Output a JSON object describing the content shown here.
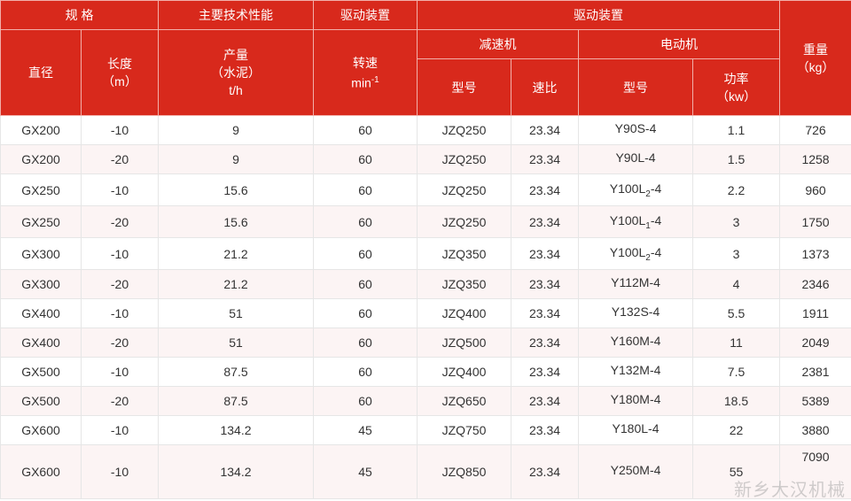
{
  "header": {
    "spec": "规 格",
    "main_tech": "主要技术性能",
    "drive1": "驱动装置",
    "drive2": "驱动装置",
    "weight_label": "重量",
    "weight_unit": "（kg）",
    "diameter": "直径",
    "length_label": "长度",
    "length_unit": "（m）",
    "output_label": "产量",
    "output_sub": "（水泥）",
    "output_unit": "t/h",
    "speed_label": "转速",
    "speed_unit_base": "min",
    "speed_unit_exp": "-1",
    "reducer": "减速机",
    "motor": "电动机",
    "reducer_model": "型号",
    "ratio": "速比",
    "motor_model": "型号",
    "power_label": "功率",
    "power_unit": "（kw）"
  },
  "rows": [
    {
      "diameter": "GX200",
      "length": "-10",
      "output": "9",
      "speed": "60",
      "reducer": "JZQ250",
      "ratio": "23.34",
      "motor_pre": "Y90S-4",
      "motor_sub": "",
      "motor_post": "",
      "power": "1.1",
      "weight": "726"
    },
    {
      "diameter": "GX200",
      "length": "-20",
      "output": "9",
      "speed": "60",
      "reducer": "JZQ250",
      "ratio": "23.34",
      "motor_pre": "Y90L-4",
      "motor_sub": "",
      "motor_post": "",
      "power": "1.5",
      "weight": "1258"
    },
    {
      "diameter": "GX250",
      "length": "-10",
      "output": "15.6",
      "speed": "60",
      "reducer": "JZQ250",
      "ratio": "23.34",
      "motor_pre": "Y100L",
      "motor_sub": "2",
      "motor_post": "-4",
      "power": "2.2",
      "weight": "960"
    },
    {
      "diameter": "GX250",
      "length": "-20",
      "output": "15.6",
      "speed": "60",
      "reducer": "JZQ250",
      "ratio": "23.34",
      "motor_pre": "Y100L",
      "motor_sub": "1",
      "motor_post": "-4",
      "power": "3",
      "weight": "1750"
    },
    {
      "diameter": "GX300",
      "length": "-10",
      "output": "21.2",
      "speed": "60",
      "reducer": "JZQ350",
      "ratio": "23.34",
      "motor_pre": "Y100L",
      "motor_sub": "2",
      "motor_post": "-4",
      "power": "3",
      "weight": "1373"
    },
    {
      "diameter": "GX300",
      "length": "-20",
      "output": "21.2",
      "speed": "60",
      "reducer": "JZQ350",
      "ratio": "23.34",
      "motor_pre": "Y112M-4",
      "motor_sub": "",
      "motor_post": "",
      "power": "4",
      "weight": "2346"
    },
    {
      "diameter": "GX400",
      "length": "-10",
      "output": "51",
      "speed": "60",
      "reducer": "JZQ400",
      "ratio": "23.34",
      "motor_pre": "Y132S-4",
      "motor_sub": "",
      "motor_post": "",
      "power": "5.5",
      "weight": "1911"
    },
    {
      "diameter": "GX400",
      "length": "-20",
      "output": "51",
      "speed": "60",
      "reducer": "JZQ500",
      "ratio": "23.34",
      "motor_pre": "Y160M-4",
      "motor_sub": "",
      "motor_post": "",
      "power": "11",
      "weight": "2049"
    },
    {
      "diameter": "GX500",
      "length": "-10",
      "output": "87.5",
      "speed": "60",
      "reducer": "JZQ400",
      "ratio": "23.34",
      "motor_pre": "Y132M-4",
      "motor_sub": "",
      "motor_post": "",
      "power": "7.5",
      "weight": "2381"
    },
    {
      "diameter": "GX500",
      "length": "-20",
      "output": "87.5",
      "speed": "60",
      "reducer": "JZQ650",
      "ratio": "23.34",
      "motor_pre": "Y180M-4",
      "motor_sub": "",
      "motor_post": "",
      "power": "18.5",
      "weight": "5389"
    },
    {
      "diameter": "GX600",
      "length": "-10",
      "output": "134.2",
      "speed": "45",
      "reducer": "JZQ750",
      "ratio": "23.34",
      "motor_pre": "Y180L-4",
      "motor_sub": "",
      "motor_post": "",
      "power": "22",
      "weight": "3880"
    },
    {
      "diameter": "GX600",
      "length": "-10",
      "output": "134.2",
      "speed": "45",
      "reducer": "JZQ850",
      "ratio": "23.34",
      "motor_pre": "Y250M-4",
      "motor_sub": "",
      "motor_post": "",
      "power": "55",
      "weight": "7090"
    }
  ],
  "watermark": "新乡大汉机械",
  "colors": {
    "header_bg": "#d8291c",
    "header_text": "#ffffff",
    "row_alt_bg": "#fcf4f4"
  }
}
